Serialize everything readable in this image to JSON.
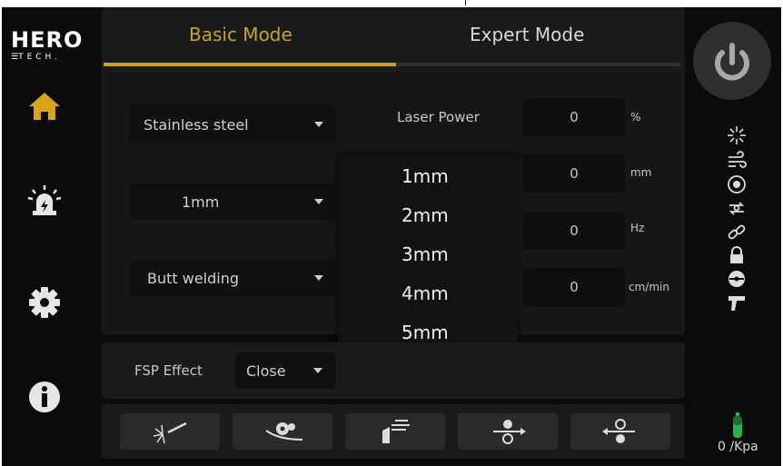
{
  "brand": {
    "logo_main": "HERO",
    "logo_sub": "TECH."
  },
  "tabs": {
    "basic": "Basic Mode",
    "expert": "Expert Mode"
  },
  "left_dropdowns": {
    "material": "Stainless steel",
    "thickness": "1mm",
    "weld_type": "Butt welding"
  },
  "params": {
    "laser_power": {
      "label": "Laser Power",
      "value": "0",
      "unit": "%"
    },
    "row2": {
      "value": "0",
      "unit": "mm"
    },
    "row3": {
      "value": "0",
      "unit": "Hz"
    },
    "row4": {
      "value": "0",
      "unit": "cm/min"
    }
  },
  "popup": {
    "options": [
      "1mm",
      "2mm",
      "3mm",
      "4mm",
      "5mm"
    ]
  },
  "fsp": {
    "label": "FSP Effect",
    "value": "Close"
  },
  "pressure": {
    "text": "0 /Kpa"
  },
  "colors": {
    "accent": "#c9a227",
    "background": "#0b0b0b",
    "panel": "#1a1a1a",
    "green": "#2bb24c"
  }
}
